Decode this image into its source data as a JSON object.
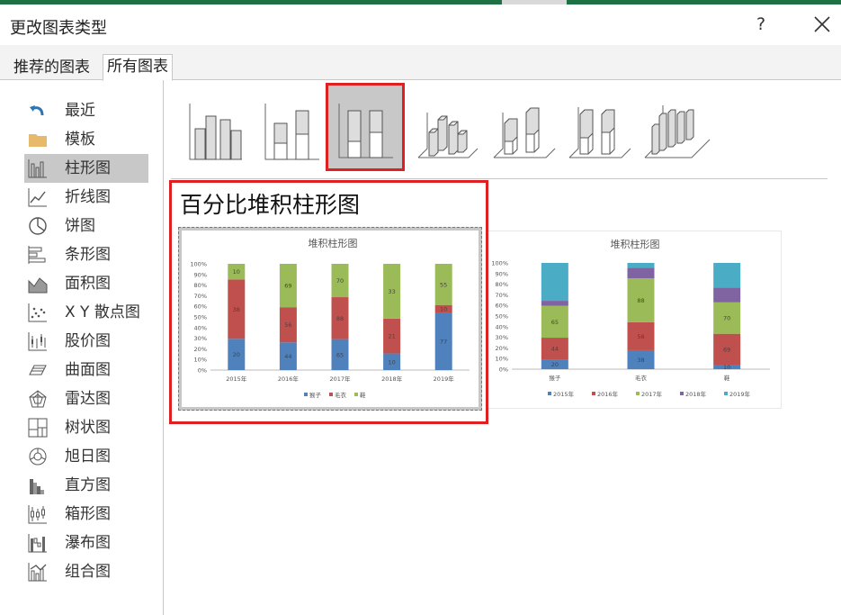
{
  "window": {
    "title": "更改图表类型",
    "help": "?"
  },
  "tabs": [
    {
      "label": "推荐的图表"
    },
    {
      "label": "所有图表"
    }
  ],
  "sidebar": {
    "items": [
      {
        "label": "最近",
        "icon": "recent-icon"
      },
      {
        "label": "模板",
        "icon": "folder-icon"
      },
      {
        "label": "柱形图",
        "icon": "column-chart-icon",
        "selected": true
      },
      {
        "label": "折线图",
        "icon": "line-chart-icon"
      },
      {
        "label": "饼图",
        "icon": "pie-chart-icon"
      },
      {
        "label": "条形图",
        "icon": "bar-chart-icon"
      },
      {
        "label": "面积图",
        "icon": "area-chart-icon"
      },
      {
        "label": "X Y 散点图",
        "icon": "scatter-chart-icon"
      },
      {
        "label": "股价图",
        "icon": "stock-chart-icon"
      },
      {
        "label": "曲面图",
        "icon": "surface-chart-icon"
      },
      {
        "label": "雷达图",
        "icon": "radar-chart-icon"
      },
      {
        "label": "树状图",
        "icon": "treemap-chart-icon"
      },
      {
        "label": "旭日图",
        "icon": "sunburst-chart-icon"
      },
      {
        "label": "直方图",
        "icon": "histogram-chart-icon"
      },
      {
        "label": "箱形图",
        "icon": "box-whisker-chart-icon"
      },
      {
        "label": "瀑布图",
        "icon": "waterfall-chart-icon"
      },
      {
        "label": "组合图",
        "icon": "combo-chart-icon"
      }
    ]
  },
  "subtypes": [
    {
      "icon": "clustered-column-icon"
    },
    {
      "icon": "stacked-column-icon"
    },
    {
      "icon": "percent-stacked-column-icon",
      "selected": true
    },
    {
      "icon": "3d-clustered-column-icon"
    },
    {
      "icon": "3d-stacked-column-icon"
    },
    {
      "icon": "3d-percent-stacked-column-icon"
    },
    {
      "icon": "3d-column-icon"
    }
  ],
  "preview": {
    "title": "百分比堆积柱形图"
  },
  "colors": {
    "s1": "#4f81bd",
    "s2": "#c0504d",
    "s3": "#9bbb59",
    "s4": "#8064a2",
    "s5": "#4bacc6",
    "accent_red": "#e02020",
    "title_green": "#1e7145"
  },
  "chart_data": [
    {
      "type": "bar",
      "stacked": "percent",
      "title": "堆积柱形图",
      "categories": [
        "2015年",
        "2016年",
        "2017年",
        "2018年",
        "2019年"
      ],
      "series": [
        {
          "name": "猴子",
          "values": [
            20,
            44,
            65,
            10,
            77
          ]
        },
        {
          "name": "毛衣",
          "values": [
            38,
            56,
            88,
            21,
            10
          ]
        },
        {
          "name": "鞋",
          "values": [
            10,
            69,
            70,
            33,
            55
          ]
        }
      ],
      "ylim": [
        0,
        100
      ],
      "yticks": [
        "0%",
        "10%",
        "20%",
        "30%",
        "40%",
        "50%",
        "60%",
        "70%",
        "80%",
        "90%",
        "100%"
      ],
      "legend": "bottom"
    },
    {
      "type": "bar",
      "stacked": "percent",
      "title": "堆积柱形图",
      "categories": [
        "猴子",
        "毛衣",
        "鞋"
      ],
      "series": [
        {
          "name": "2015年",
          "values": [
            20,
            38,
            10
          ]
        },
        {
          "name": "2016年",
          "values": [
            44,
            56,
            69
          ]
        },
        {
          "name": "2017年",
          "values": [
            65,
            88,
            70
          ]
        },
        {
          "name": "2018年",
          "values": [
            10,
            21,
            33
          ]
        },
        {
          "name": "2019年",
          "values": [
            77,
            10,
            55
          ]
        }
      ],
      "ylim": [
        0,
        100
      ],
      "yticks": [
        "0%",
        "10%",
        "20%",
        "30%",
        "40%",
        "50%",
        "60%",
        "70%",
        "80%",
        "90%",
        "100%"
      ],
      "legend": "bottom"
    }
  ]
}
